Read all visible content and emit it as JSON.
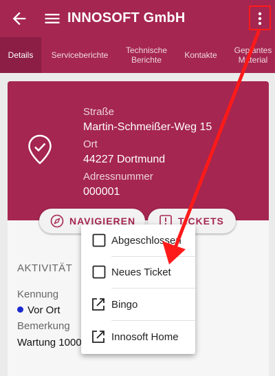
{
  "appbar": {
    "title": "INNOSOFT GmbH"
  },
  "tabs": [
    {
      "label": "Details",
      "active": true
    },
    {
      "label": "Serviceberichte",
      "active": false
    },
    {
      "label": "Technische\nBerichte",
      "active": false
    },
    {
      "label": "Kontakte",
      "active": false
    },
    {
      "label": "Geplantes\nMaterial",
      "active": false
    }
  ],
  "address": {
    "street_label": "Straße",
    "street": "Martin-Schmeißer-Weg 15",
    "city_label": "Ort",
    "city": "44227 Dortmund",
    "number_label": "Adressnummer",
    "number": "000001"
  },
  "actions": {
    "navigate": "NAVIGIEREN",
    "tickets": "TICKETS"
  },
  "activity": {
    "title": "AKTIVITÄT",
    "id_label": "Kennung",
    "id_value": "Vor Ort",
    "note_label": "Bemerkung",
    "note_value": "Wartung 1000"
  },
  "menu": {
    "items": [
      {
        "label": "Abgeschlossen",
        "icon": "checkbox-icon"
      },
      {
        "label": "Neues Ticket",
        "icon": "checkbox-icon"
      },
      {
        "label": "Bingo",
        "icon": "open-external-icon"
      },
      {
        "label": "Innosoft Home",
        "icon": "open-external-icon"
      }
    ]
  },
  "colors": {
    "primary": "#a52650",
    "primary_dark": "#8c1e45",
    "annotation": "#ff1a1a"
  }
}
